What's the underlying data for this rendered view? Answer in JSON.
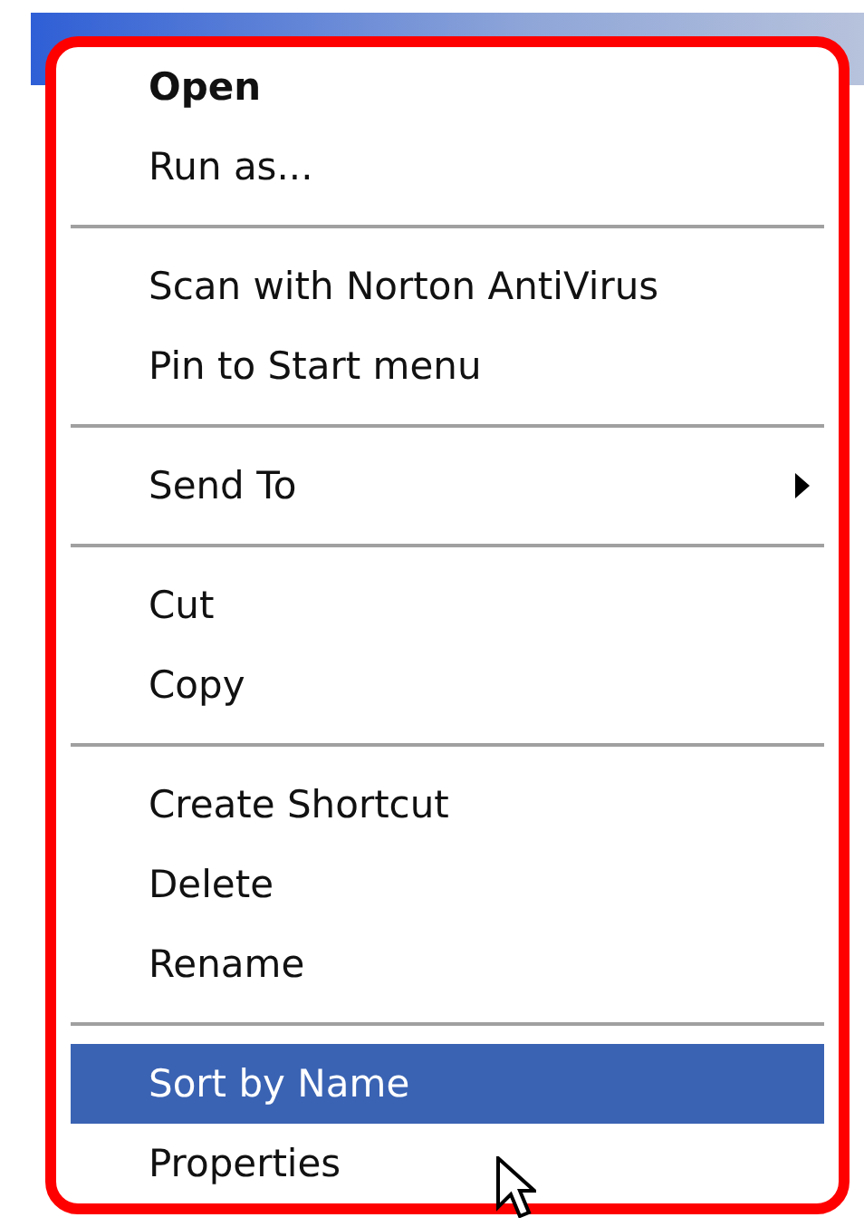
{
  "context_menu": {
    "items": [
      {
        "kind": "item",
        "label": "Open",
        "default": true,
        "selected": false,
        "submenu": false
      },
      {
        "kind": "item",
        "label": "Run as...",
        "default": false,
        "selected": false,
        "submenu": false
      },
      {
        "kind": "separator"
      },
      {
        "kind": "item",
        "label": "Scan with Norton AntiVirus",
        "default": false,
        "selected": false,
        "submenu": false
      },
      {
        "kind": "item",
        "label": "Pin to Start menu",
        "default": false,
        "selected": false,
        "submenu": false
      },
      {
        "kind": "separator"
      },
      {
        "kind": "item",
        "label": "Send To",
        "default": false,
        "selected": false,
        "submenu": true
      },
      {
        "kind": "separator"
      },
      {
        "kind": "item",
        "label": "Cut",
        "default": false,
        "selected": false,
        "submenu": false
      },
      {
        "kind": "item",
        "label": "Copy",
        "default": false,
        "selected": false,
        "submenu": false
      },
      {
        "kind": "separator"
      },
      {
        "kind": "item",
        "label": "Create Shortcut",
        "default": false,
        "selected": false,
        "submenu": false
      },
      {
        "kind": "item",
        "label": "Delete",
        "default": false,
        "selected": false,
        "submenu": false
      },
      {
        "kind": "item",
        "label": "Rename",
        "default": false,
        "selected": false,
        "submenu": false
      },
      {
        "kind": "separator"
      },
      {
        "kind": "item",
        "label": "Sort by Name",
        "default": false,
        "selected": true,
        "submenu": false
      },
      {
        "kind": "item",
        "label": "Properties",
        "default": false,
        "selected": false,
        "submenu": false
      }
    ]
  }
}
